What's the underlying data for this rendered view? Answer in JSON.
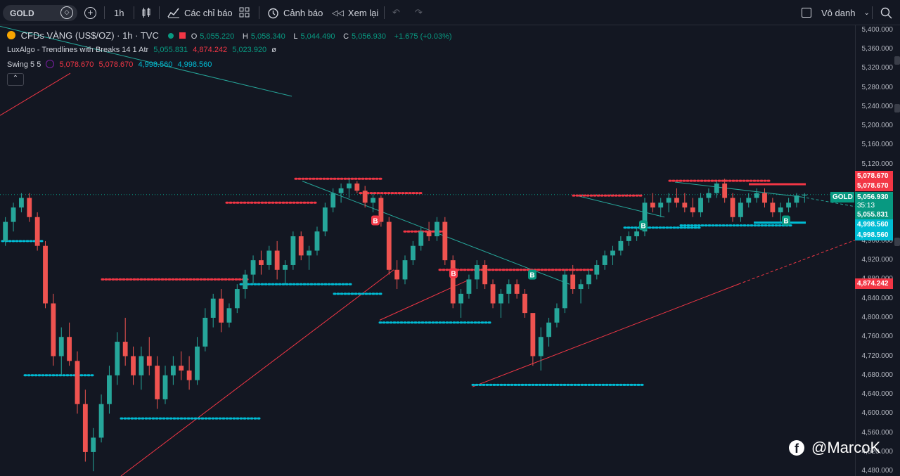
{
  "toolbar": {
    "symbol": "GOLD",
    "interval": "1h",
    "indicators_label": "Các chỉ báo",
    "alerts_label": "Cảnh báo",
    "replay_label": "Xem lại",
    "account_label": "Vô danh"
  },
  "legend": {
    "title": "CFDs VÀNG (US$/OZ) · 1h · TVC",
    "open_label": "O",
    "open": "5,055.220",
    "high_label": "H",
    "high": "5,058.340",
    "low_label": "L",
    "low": "5,044.490",
    "close_label": "C",
    "close": "5,056.930",
    "change": "+1.675 (+0.03%)",
    "ind1_name": "LuxAlgo - Trendlines with Breaks 14 1 Atr",
    "ind1_v1": "5,055.831",
    "ind1_v2": "4,874.242",
    "ind1_v3": "5,023.920",
    "ind1_v4": "ø",
    "ind2_name": "Swing 5 5",
    "ind2_v1": "5,078.670",
    "ind2_v2": "5,078.670",
    "ind2_v3": "4,998.560",
    "ind2_v4": "4,998.560"
  },
  "price_axis": {
    "ticks": [
      "5,400.000",
      "5,360.000",
      "5,320.000",
      "5,280.000",
      "5,240.000",
      "5,200.000",
      "5,160.000",
      "5,120.000",
      "4,960.000",
      "4,920.000",
      "4,880.000",
      "4,840.000",
      "4,800.000",
      "4,760.000",
      "4,720.000",
      "4,680.000",
      "4,640.000",
      "4,600.000",
      "4,560.000",
      "4,520.000",
      "4,480.000"
    ],
    "tags": {
      "swing_high_1": "5,078.670",
      "swing_high_2": "5,078.670",
      "symbol_tag": "GOLD",
      "last_price": "5,056.930",
      "countdown": "35:13",
      "trend_upper": "5,055.831",
      "swing_low_1": "4,998.560",
      "swing_low_2": "4,998.560",
      "trend_lower": "4,874.242"
    }
  },
  "chart_data": {
    "type": "candlestick",
    "ylim": [
      4470,
      5410
    ],
    "colors": {
      "up": "#26a69a",
      "down": "#ef5350",
      "swing_high": "#f23645",
      "swing_low": "#00bcd4"
    },
    "marker_label": "B",
    "candles": [
      [
        4960,
        5010,
        4950,
        5000
      ],
      [
        5000,
        5040,
        4980,
        5030
      ],
      [
        5030,
        5060,
        5020,
        5050
      ],
      [
        5050,
        5060,
        5000,
        5010
      ],
      [
        5010,
        5020,
        4940,
        4950
      ],
      [
        4950,
        4960,
        4820,
        4830
      ],
      [
        4830,
        4850,
        4700,
        4720
      ],
      [
        4720,
        4780,
        4680,
        4760
      ],
      [
        4760,
        4790,
        4700,
        4710
      ],
      [
        4710,
        4730,
        4600,
        4620
      ],
      [
        4620,
        4650,
        4500,
        4520
      ],
      [
        4520,
        4570,
        4480,
        4550
      ],
      [
        4550,
        4640,
        4540,
        4620
      ],
      [
        4620,
        4700,
        4600,
        4680
      ],
      [
        4680,
        4770,
        4660,
        4750
      ],
      [
        4750,
        4800,
        4700,
        4720
      ],
      [
        4720,
        4740,
        4660,
        4680
      ],
      [
        4680,
        4740,
        4650,
        4720
      ],
      [
        4720,
        4760,
        4680,
        4700
      ],
      [
        4700,
        4720,
        4610,
        4630
      ],
      [
        4630,
        4700,
        4620,
        4680
      ],
      [
        4680,
        4720,
        4660,
        4700
      ],
      [
        4700,
        4730,
        4670,
        4690
      ],
      [
        4690,
        4720,
        4650,
        4670
      ],
      [
        4670,
        4760,
        4660,
        4740
      ],
      [
        4740,
        4820,
        4730,
        4800
      ],
      [
        4800,
        4850,
        4780,
        4840
      ],
      [
        4840,
        4860,
        4770,
        4790
      ],
      [
        4790,
        4830,
        4780,
        4820
      ],
      [
        4820,
        4870,
        4810,
        4860
      ],
      [
        4860,
        4900,
        4840,
        4890
      ],
      [
        4890,
        4930,
        4870,
        4920
      ],
      [
        4920,
        4940,
        4890,
        4910
      ],
      [
        4910,
        4950,
        4900,
        4940
      ],
      [
        4940,
        4960,
        4880,
        4900
      ],
      [
        4900,
        4920,
        4870,
        4910
      ],
      [
        4910,
        4980,
        4900,
        4970
      ],
      [
        4970,
        4980,
        4920,
        4930
      ],
      [
        4930,
        4950,
        4900,
        4940
      ],
      [
        4940,
        4990,
        4930,
        4980
      ],
      [
        4980,
        5040,
        4970,
        5030
      ],
      [
        5030,
        5070,
        5020,
        5060
      ],
      [
        5060,
        5080,
        5040,
        5070
      ],
      [
        5070,
        5090,
        5050,
        5080
      ],
      [
        5080,
        5085,
        5060,
        5065
      ],
      [
        5065,
        5075,
        5030,
        5040
      ],
      [
        5040,
        5060,
        5020,
        5050
      ],
      [
        5050,
        5055,
        4990,
        5000
      ],
      [
        5000,
        5010,
        4890,
        4900
      ],
      [
        4900,
        4920,
        4860,
        4880
      ],
      [
        4880,
        4930,
        4870,
        4920
      ],
      [
        4920,
        4960,
        4910,
        4950
      ],
      [
        4950,
        4990,
        4940,
        4980
      ],
      [
        4980,
        5000,
        4960,
        4970
      ],
      [
        4970,
        5010,
        4960,
        5000
      ],
      [
        5000,
        5010,
        4910,
        4920
      ],
      [
        4920,
        4930,
        4820,
        4830
      ],
      [
        4830,
        4860,
        4800,
        4850
      ],
      [
        4850,
        4890,
        4840,
        4880
      ],
      [
        4880,
        4920,
        4860,
        4910
      ],
      [
        4910,
        4920,
        4860,
        4870
      ],
      [
        4870,
        4880,
        4820,
        4830
      ],
      [
        4830,
        4860,
        4800,
        4850
      ],
      [
        4850,
        4880,
        4830,
        4870
      ],
      [
        4870,
        4880,
        4840,
        4850
      ],
      [
        4850,
        4860,
        4800,
        4810
      ],
      [
        4810,
        4780,
        4700,
        4720
      ],
      [
        4720,
        4780,
        4690,
        4760
      ],
      [
        4760,
        4800,
        4740,
        4790
      ],
      [
        4790,
        4830,
        4780,
        4820
      ],
      [
        4820,
        4900,
        4810,
        4890
      ],
      [
        4890,
        4910,
        4850,
        4860
      ],
      [
        4860,
        4880,
        4830,
        4870
      ],
      [
        4870,
        4900,
        4860,
        4890
      ],
      [
        4890,
        4920,
        4880,
        4910
      ],
      [
        4910,
        4940,
        4900,
        4930
      ],
      [
        4930,
        4950,
        4910,
        4940
      ],
      [
        4940,
        4970,
        4930,
        4960
      ],
      [
        4960,
        4980,
        4950,
        4970
      ],
      [
        4970,
        4990,
        4960,
        4980
      ],
      [
        4980,
        5050,
        4970,
        5040
      ],
      [
        5040,
        5060,
        5020,
        5030
      ],
      [
        5030,
        5050,
        5010,
        5040
      ],
      [
        5040,
        5060,
        5020,
        5050
      ],
      [
        5050,
        5070,
        5030,
        5040
      ],
      [
        5040,
        5060,
        5020,
        5030
      ],
      [
        5030,
        5050,
        5010,
        5020
      ],
      [
        5020,
        5060,
        5010,
        5050
      ],
      [
        5050,
        5070,
        5040,
        5060
      ],
      [
        5060,
        5085,
        5050,
        5080
      ],
      [
        5080,
        5090,
        5040,
        5050
      ],
      [
        5050,
        5060,
        5000,
        5010
      ],
      [
        5010,
        5050,
        5000,
        5040
      ],
      [
        5040,
        5060,
        5030,
        5050
      ],
      [
        5050,
        5070,
        5040,
        5060
      ],
      [
        5060,
        5070,
        5030,
        5040
      ],
      [
        5040,
        5050,
        5010,
        5020
      ],
      [
        5020,
        5040,
        5000,
        5030
      ],
      [
        5030,
        5050,
        5020,
        5040
      ],
      [
        5040,
        5060,
        5030,
        5055
      ],
      [
        5055,
        5060,
        5040,
        5057
      ]
    ],
    "swing_highs": [
      5090,
      5060,
      5040,
      4980,
      4880,
      4900,
      5055,
      5078.67
    ],
    "swing_lows": [
      4960,
      4680,
      4590,
      4870,
      4850,
      4790,
      4660,
      4990,
      4998.56
    ],
    "trendlines": [
      {
        "from": [
          4998,
          5010
        ],
        "to": [
          4920,
          4905
        ],
        "style": "solid",
        "role": "down"
      },
      {
        "from": [
          4480,
          4850
        ],
        "to": [
          4850,
          4880
        ],
        "style": "solid",
        "role": "up"
      },
      {
        "from": [
          4660,
          4880
        ],
        "to": [
          4940,
          4960
        ],
        "style": "dashed",
        "role": "up"
      }
    ]
  }
}
